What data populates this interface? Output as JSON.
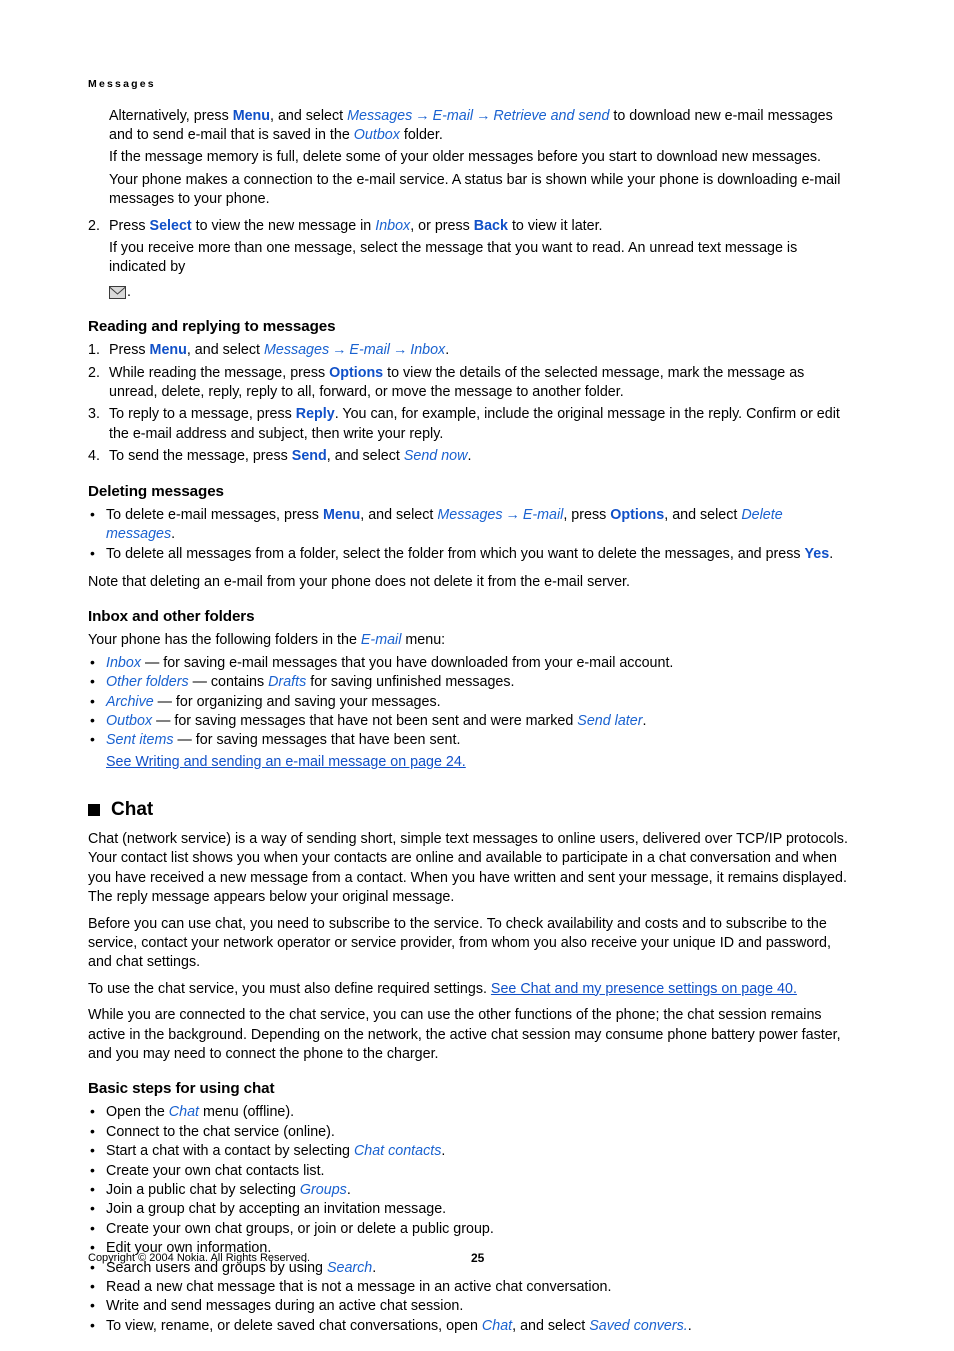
{
  "page": {
    "running_header": "Messages",
    "footer_copyright": "Copyright © 2004 Nokia. All Rights Reserved.",
    "page_number": "25",
    "link_color": "#1050c8",
    "italic_color": "#1a62d0",
    "text_color": "#000000"
  },
  "intro": {
    "alt_p1_a": "Alternatively, press ",
    "alt_p1_menu": "Menu",
    "alt_p1_b": ", and select ",
    "alt_p1_messages": "Messages",
    "alt_arrow1": "→",
    "alt_p1_email": "E-mail",
    "alt_arrow2": "→",
    "alt_p1_retrieve": "Retrieve and send",
    "alt_p1_c": " to download new e-mail messages and to send e-mail that is saved in the ",
    "alt_p1_outbox": "Outbox",
    "alt_p1_d": " folder.",
    "memory_full": "If the message memory is full, delete some of your older messages before you start to download new messages.",
    "connection": "Your phone makes a connection to the e-mail service. A status bar is shown while your phone is downloading e-mail messages to your phone."
  },
  "step2": {
    "num": "2.",
    "a": "Press ",
    "select": "Select",
    "b": " to view the new message in ",
    "inbox": "Inbox",
    "c": ", or press ",
    "back": "Back",
    "d": " to view it later.",
    "sub": "If you receive more than one message, select the message that you want to read. An unread text message is indicated by",
    "env_suffix": "."
  },
  "reading": {
    "heading": "Reading and replying to messages",
    "steps": [
      {
        "num": "1.",
        "a": "Press ",
        "menu": "Menu",
        "b": ", and select ",
        "messages": "Messages",
        "arrow1": "→",
        "email": "E-mail",
        "arrow2": "→",
        "inbox": "Inbox",
        "c": "."
      },
      {
        "num": "2.",
        "a": "While reading the message, press ",
        "options": "Options",
        "b": " to view the details of the selected message, mark the message as unread, delete, reply, reply to all, forward, or move the message to another folder."
      },
      {
        "num": "3.",
        "a": "To reply to a message, press ",
        "reply": "Reply",
        "b": ". You can, for example, include the original message in the reply. Confirm or edit the e-mail address and subject, then write your reply."
      },
      {
        "num": "4.",
        "a": "To send the message, press ",
        "send": "Send",
        "b": ", and select ",
        "send_now": "Send now",
        "c": "."
      }
    ]
  },
  "deleting": {
    "heading": "Deleting messages",
    "b1_a": "To delete e-mail messages, press ",
    "b1_menu": "Menu",
    "b1_b": ", and select ",
    "b1_messages": "Messages",
    "b1_arrow": "→",
    "b1_email": "E-mail",
    "b1_c": ", press ",
    "b1_options": "Options",
    "b1_d": ", and select ",
    "b1_delete_messages": "Delete messages",
    "b1_e": ".",
    "b2_a": "To delete all messages from a folder, select the folder from which you want to delete the messages, and press ",
    "b2_yes": "Yes",
    "b2_b": ".",
    "note": "Note that deleting an e-mail from your phone does not delete it from the e-mail server."
  },
  "inbox_folders": {
    "heading": "Inbox and other folders",
    "intro_a": "Your phone has the following folders in the ",
    "intro_email": "E-mail",
    "intro_b": " menu:",
    "items": [
      {
        "term": "Inbox",
        "rest": " — for saving e-mail messages that you have downloaded from your e-mail account."
      },
      {
        "term": "Other folders",
        "rest_a": " — contains ",
        "term2": "Drafts",
        "rest_b": " for saving unfinished messages."
      },
      {
        "term": "Archive",
        "rest": " — for organizing and saving your messages."
      },
      {
        "term": "Outbox",
        "rest_a": "  — for saving messages that have not been sent and were marked ",
        "term2": "Send later",
        "rest_b": "."
      },
      {
        "term": "Sent items",
        "rest": " — for saving messages that have been sent."
      }
    ],
    "see_link": "See Writing and sending an e-mail message on page 24."
  },
  "chat": {
    "heading": "Chat",
    "p1": "Chat (network service) is a way of sending short, simple text messages to online users, delivered over TCP/IP protocols. Your contact list shows you when your contacts are online and available to participate in a chat conversation and when you have received a new message from a contact. When you have written and sent your message, it remains displayed. The reply message appears below your original message.",
    "p2": "Before you can use chat, you need to subscribe to the service. To check availability and costs and to subscribe to the service, contact your network operator or service provider, from whom you also receive your unique ID and password, and chat settings.",
    "p3_a": "To use the chat service, you must also define required settings. ",
    "p3_link": "See Chat and my presence settings on page 40.",
    "p4": "While you are connected to the chat service, you can use the other functions of the phone; the chat session remains active in the background. Depending on the network, the active chat session may consume phone battery power faster, and you may need to connect the phone to the charger."
  },
  "basic_steps": {
    "heading": "Basic steps for using chat",
    "items": [
      {
        "a": "Open the ",
        "it": "Chat",
        "b": " menu (offline)."
      },
      {
        "a": "Connect to the chat service (online)."
      },
      {
        "a": "Start a chat with a contact by selecting ",
        "it": "Chat contacts",
        "b": "."
      },
      {
        "a": "Create your own chat contacts list."
      },
      {
        "a": "Join a public chat by selecting ",
        "it": "Groups",
        "b": "."
      },
      {
        "a": "Join a group chat by accepting an invitation message."
      },
      {
        "a": "Create your own chat groups, or join or delete a public group."
      },
      {
        "a": "Edit your own information."
      },
      {
        "a": "Search users and groups by using ",
        "it": "Search",
        "b": "."
      },
      {
        "a": "Read a new chat message that is not a message in an active chat conversation."
      },
      {
        "a": "Write and send messages during an active chat session."
      },
      {
        "a": "To view, rename, or delete saved chat conversations, open ",
        "it": "Chat",
        "b": ", and select ",
        "it2": "Saved convers.",
        "c": "."
      }
    ]
  }
}
